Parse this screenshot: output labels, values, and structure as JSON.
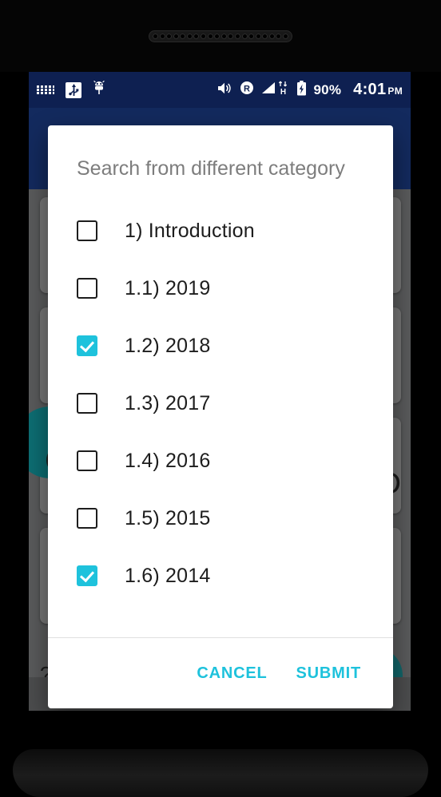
{
  "device": {
    "speaker_icon": "speaker-grille",
    "nav": {
      "back_icon": "back-triangle-icon",
      "home_icon": "home-circle-icon",
      "recents_icon": "recents-square-icon"
    }
  },
  "status_bar": {
    "left_icons": [
      {
        "name": "keyboard-icon",
        "glyph": "keyboard"
      },
      {
        "name": "usb-icon",
        "glyph": "usb"
      },
      {
        "name": "adb-bug-icon",
        "glyph": "bug"
      }
    ],
    "right_icons": [
      {
        "name": "volume-icon",
        "glyph": "volume"
      },
      {
        "name": "roaming-icon",
        "glyph": "R"
      },
      {
        "name": "signal-icon",
        "glyph": "signal"
      },
      {
        "name": "data-hspa-icon",
        "glyph": "H"
      },
      {
        "name": "battery-charging-icon",
        "glyph": "battery"
      }
    ],
    "battery_percent": "90%",
    "time": "4:01",
    "meridiem": "PM",
    "background_color": "#0e2051"
  },
  "dialog": {
    "title": "Search from different category",
    "accent_color": "#1ec2dc",
    "options": [
      {
        "label": "1) Introduction",
        "checked": false
      },
      {
        "label": "1.1) 2019",
        "checked": false
      },
      {
        "label": "1.2) 2018",
        "checked": true
      },
      {
        "label": "1.3) 2017",
        "checked": false
      },
      {
        "label": "1.4) 2016",
        "checked": false
      },
      {
        "label": "1.5) 2015",
        "checked": false
      },
      {
        "label": "1.6) 2014",
        "checked": true
      }
    ],
    "cancel_label": "CANCEL",
    "submit_label": "SUBMIT"
  },
  "background_app": {
    "appbar_color": "#132a5e",
    "scrim_color": "#5a5b5c",
    "avatar_color": "#8a2048",
    "fab_color": "#0d6e73",
    "glyph_left": "C",
    "glyph_right_small": "o",
    "glyph_right_large": "D",
    "glyph_question": "?"
  }
}
